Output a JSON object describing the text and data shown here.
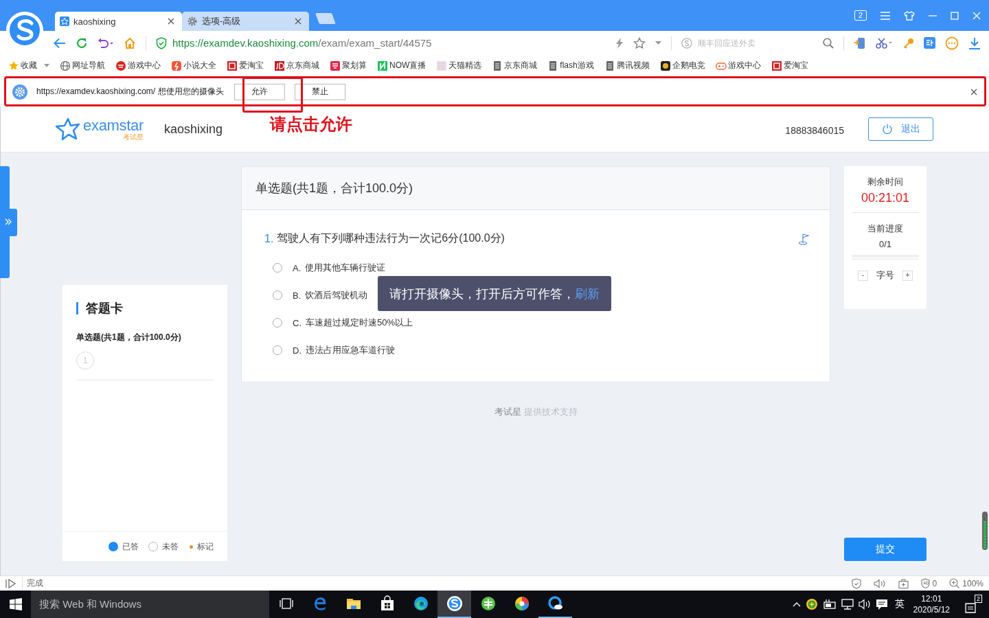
{
  "browser": {
    "tabs": [
      {
        "title": "kaoshixing",
        "kind": "site",
        "selected": true
      },
      {
        "title": "选项-高级",
        "kind": "settings",
        "selected": false
      }
    ],
    "tab_count": "2",
    "address": {
      "scheme": "https://",
      "host": "examdev.kaoshixing.com",
      "path": "/exam/exam_start/44575"
    },
    "search": {
      "placeholder": "顺丰回应送外卖"
    },
    "bookmarks": [
      {
        "label": "收藏",
        "kind": "star",
        "has_menu": true
      },
      {
        "label": "网址导航",
        "kind": "globe",
        "has_menu": false
      },
      {
        "label": "游戏中心",
        "kind": "game",
        "has_menu": false
      },
      {
        "label": "小说大全",
        "kind": "novel",
        "has_menu": false
      },
      {
        "label": "爱淘宝",
        "kind": "tao",
        "has_menu": false
      },
      {
        "label": "京东商城",
        "kind": "jd",
        "has_menu": false
      },
      {
        "label": "聚划算",
        "kind": "ju",
        "has_menu": false
      },
      {
        "label": "NOW直播",
        "kind": "now",
        "has_menu": false
      },
      {
        "label": "天猫精选",
        "kind": "tmall",
        "has_menu": false
      },
      {
        "label": "京东商城",
        "kind": "page",
        "has_menu": false
      },
      {
        "label": "flash游戏",
        "kind": "page",
        "has_menu": false
      },
      {
        "label": "腾讯视频",
        "kind": "page",
        "has_menu": false
      },
      {
        "label": "企鹅电竞",
        "kind": "esports",
        "has_menu": false
      },
      {
        "label": "游戏中心",
        "kind": "gamepad",
        "has_menu": false
      },
      {
        "label": "爱淘宝",
        "kind": "tao",
        "has_menu": false
      }
    ],
    "permission": {
      "message": "https://examdev.kaoshixing.com/ 想使用您的摄像头",
      "buttons": [
        "允许",
        "禁止"
      ]
    },
    "annotation": "请点击允许"
  },
  "page": {
    "header": {
      "brand": "examstar",
      "brand_sub": "考试星",
      "site": "kaoshixing",
      "phone": "18883846015",
      "logout": "退出"
    },
    "answer_card": {
      "title": "答题卡",
      "section": "单选题(共1题，合计100.0分)",
      "numbers": [
        {
          "label": "1",
          "answered": false
        }
      ],
      "legend": [
        {
          "label": "已答",
          "kind": "answered"
        },
        {
          "label": "未答",
          "kind": "unanswered"
        },
        {
          "label": "标记",
          "kind": "marked"
        }
      ]
    },
    "section_title": "单选题(共1题，合计100.0分)",
    "question": {
      "number": "1.",
      "text": "驾驶人有下列哪种违法行为一次记6分(100.0分)",
      "options": [
        {
          "letter": "A.",
          "text": "使用其他车辆行驶证",
          "selected": false
        },
        {
          "letter": "B.",
          "text": "饮酒后驾驶机动",
          "selected": false
        },
        {
          "letter": "C.",
          "text": "车速超过规定时速50%以上",
          "selected": false
        },
        {
          "letter": "D.",
          "text": "违法占用应急车道行驶",
          "selected": false
        }
      ]
    },
    "toast": {
      "text": "请打开摄像头，打开后方可作答，",
      "link": "刷新"
    },
    "footer": {
      "brand": "考试星",
      "text": "提供技术支持"
    },
    "timer": {
      "label": "剩余时间",
      "value": "00:21:01"
    },
    "progress": {
      "label": "当前进度",
      "value": "0/1",
      "level": 0
    },
    "font_size": {
      "label": "字号",
      "decrease": "-",
      "increase": "+"
    },
    "submit": "提交"
  },
  "status_bar": {
    "text": "完成",
    "ad_count": "0",
    "zoom": "100%"
  },
  "taskbar": {
    "search": "搜索 Web 和 Windows",
    "apps": [
      {
        "kind": "taskview",
        "selected": false,
        "running": false
      },
      {
        "kind": "edge",
        "selected": false,
        "running": false
      },
      {
        "kind": "folder",
        "selected": false,
        "running": false
      },
      {
        "kind": "store",
        "selected": false,
        "running": false
      },
      {
        "kind": "edgenew",
        "selected": false,
        "running": false
      },
      {
        "kind": "sogou",
        "selected": true,
        "running": true
      },
      {
        "kind": "green",
        "selected": false,
        "running": false
      },
      {
        "kind": "pinwheel",
        "selected": false,
        "running": false
      },
      {
        "kind": "qq",
        "selected": false,
        "running": true
      }
    ],
    "ime": "英",
    "time": "12:01",
    "date": "2020/5/12",
    "notifications": "2"
  }
}
